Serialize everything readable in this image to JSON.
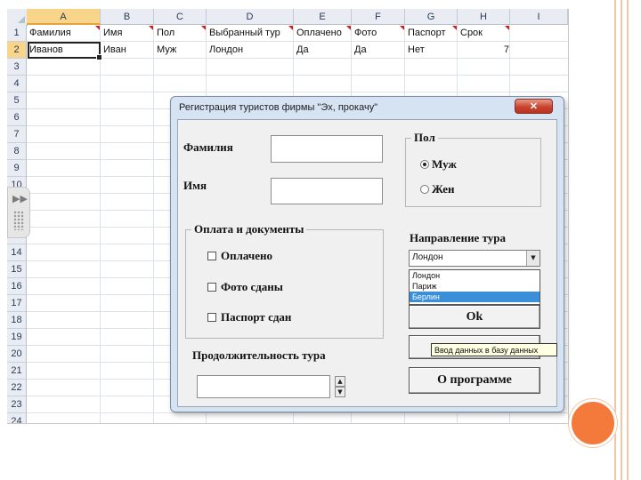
{
  "sheet": {
    "columns": [
      "A",
      "B",
      "C",
      "D",
      "E",
      "F",
      "G",
      "H",
      "I"
    ],
    "rows": [
      "1",
      "2",
      "3",
      "4",
      "5",
      "6",
      "7",
      "8",
      "9",
      "10",
      "11",
      "12",
      "13",
      "14",
      "15",
      "16",
      "17",
      "18",
      "19",
      "20",
      "21",
      "22",
      "23",
      "24"
    ],
    "header_row": [
      "Фамилия",
      "Имя",
      "Пол",
      "Выбранный тур",
      "Оплачено",
      "Фото",
      "Паспорт",
      "Срок",
      ""
    ],
    "data_row": [
      "Иванов",
      "Иван",
      "Муж",
      "Лондон",
      "Да",
      "Да",
      "Нет",
      "7",
      ""
    ],
    "active_cell": "A2"
  },
  "dialog": {
    "title": "Регистрация туристов фирмы \"Эх, прокачу\"",
    "close_icon": "close-x-icon",
    "surname_label": "Фамилия",
    "name_label": "Имя",
    "gender_frame": "Пол",
    "gender_options": [
      "Муж",
      "Жен"
    ],
    "gender_selected": "Муж",
    "payment_frame": "Оплата и документы",
    "checkboxes": [
      "Оплачено",
      "Фото сданы",
      "Паспорт сдан"
    ],
    "duration_label": "Продолжительность тура",
    "direction_label": "Направление тура",
    "direction_value": "Лондон",
    "direction_options": [
      "Лондон",
      "Париж",
      "Берлин"
    ],
    "direction_highlighted": "Берлин",
    "ok_button": "Ok",
    "tooltip": "Ввод данных в базу данных",
    "about_button": "О программе"
  },
  "colors": {
    "accent_circle": "#f47a3c",
    "selection_header": "#f8d58a",
    "dropdown_highlight": "#3b8fd8",
    "close_button": "#c9442f"
  }
}
